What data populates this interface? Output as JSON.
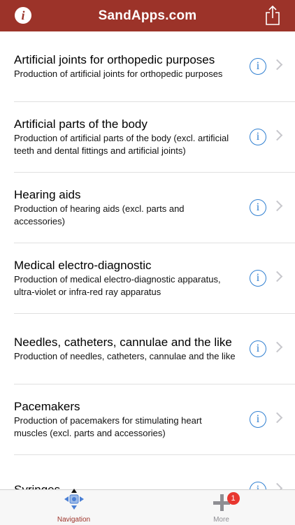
{
  "header": {
    "title": "SandApps.com",
    "info_glyph": "i",
    "info_icon": "info-icon",
    "share_icon": "share-icon"
  },
  "items": [
    {
      "title": "Artificial joints for orthopedic purposes",
      "subtitle": "Production of artificial joints for orthopedic purposes"
    },
    {
      "title": "Artificial parts of the body",
      "subtitle": "Production of artificial parts of the body (excl. artificial teeth and dental fittings and artificial joints)"
    },
    {
      "title": "Hearing aids",
      "subtitle": "Production of hearing aids (excl. parts and accessories)"
    },
    {
      "title": "Medical electro-diagnostic",
      "subtitle": "Production of medical electro-diagnostic apparatus, ultra-violet or infra-red ray apparatus"
    },
    {
      "title": "Needles, catheters, cannulae and the like",
      "subtitle": "Production of needles, catheters, cannulae and the like"
    },
    {
      "title": "Pacemakers",
      "subtitle": "Production of pacemakers for stimulating heart muscles (excl. parts and accessories)"
    },
    {
      "title": "Syringes",
      "subtitle": ""
    }
  ],
  "row_info_glyph": "i",
  "tabs": {
    "navigation": {
      "label": "Navigation",
      "icon": "navigation-icon"
    },
    "more": {
      "label": "More",
      "icon": "plus-icon",
      "badge": "1"
    }
  },
  "colors": {
    "accent": "#9c3329",
    "link": "#2f7fd1",
    "badge": "#e8362f"
  }
}
